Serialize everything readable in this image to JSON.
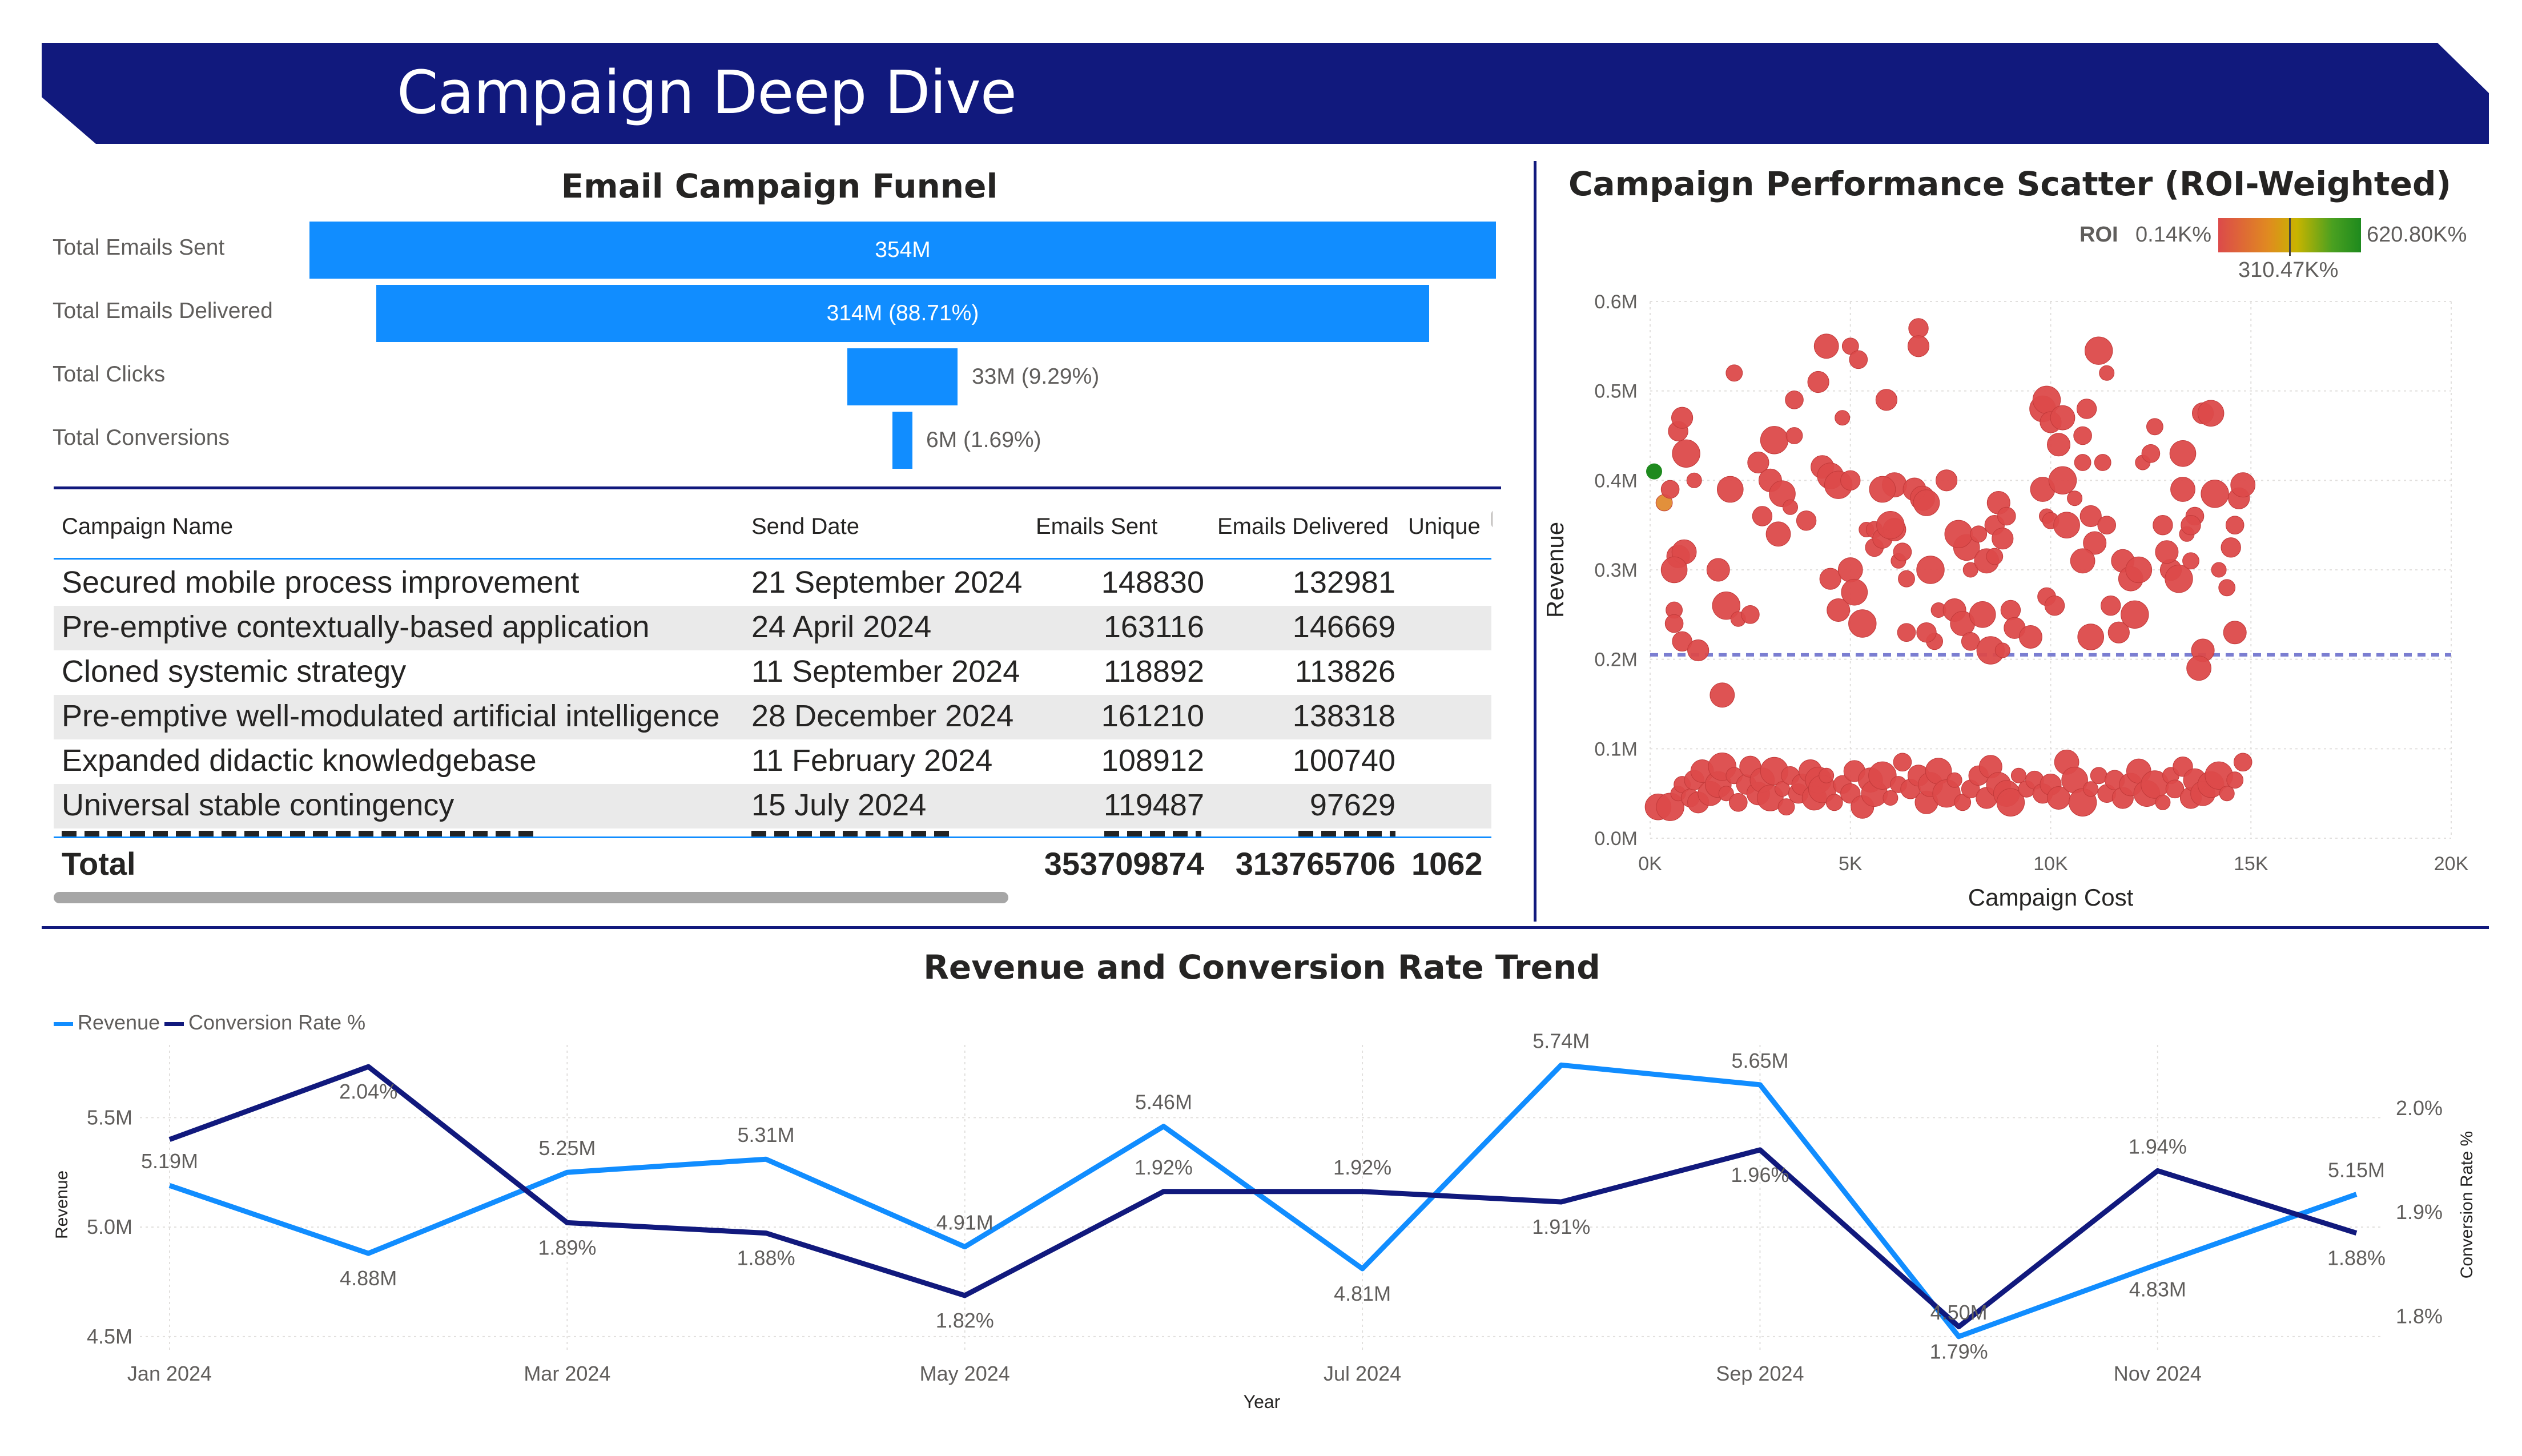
{
  "header": {
    "title": "Campaign Deep Dive",
    "color": "#11197d"
  },
  "funnel": {
    "title": "Email Campaign Funnel",
    "bar_color": "#118dff",
    "stages": [
      {
        "label": "Total Emails Sent",
        "value_label": "354M",
        "value": 354
      },
      {
        "label": "Total Emails Delivered",
        "value_label": "314M (88.71%)",
        "value": 314
      },
      {
        "label": "Total Clicks",
        "value_label": "33M (9.29%)",
        "value": 33
      },
      {
        "label": "Total Conversions",
        "value_label": "6M (1.69%)",
        "value": 6
      }
    ]
  },
  "table": {
    "columns": [
      "Campaign Name",
      "Send Date",
      "Emails Sent",
      "Emails Delivered",
      "Unique"
    ],
    "rows": [
      [
        "Secured mobile process improvement",
        "21 September 2024",
        "148830",
        "132981"
      ],
      [
        "Pre-emptive contextually-based application",
        "24 April 2024",
        "163116",
        "146669"
      ],
      [
        "Cloned systemic strategy",
        "11 September 2024",
        "118892",
        "113826"
      ],
      [
        "Pre-emptive well-modulated artificial intelligence",
        "28 December 2024",
        "161210",
        "138318"
      ],
      [
        "Expanded didactic knowledgebase",
        "11 February 2024",
        "108912",
        "100740"
      ],
      [
        "Universal stable contingency",
        "15 July 2024",
        "119487",
        "97629"
      ]
    ],
    "total": {
      "label": "Total",
      "emails_sent": "353709874",
      "emails_delivered": "313765706",
      "unique": "1062"
    }
  },
  "scatter": {
    "title": "Campaign Performance Scatter (ROI-Weighted)",
    "roi_legend": {
      "label": "ROI",
      "min": "0.14K%",
      "mid": "310.47K%",
      "max": "620.80K%"
    },
    "x_axis_title": "Campaign Cost",
    "y_axis_title": "Revenue",
    "x_ticks": [
      "0K",
      "5K",
      "10K",
      "15K",
      "20K"
    ],
    "y_ticks": [
      "0.0M",
      "0.1M",
      "0.2M",
      "0.3M",
      "0.4M",
      "0.5M",
      "0.6M"
    ],
    "average_line_value": 0.205
  },
  "trend": {
    "title": "Revenue and Conversion Rate Trend",
    "x_axis_title": "Year",
    "y_left_title": "Revenue",
    "y_right_title": "Conversion Rate %",
    "x_ticks": [
      "Jan 2024",
      "Mar 2024",
      "May 2024",
      "Jul 2024",
      "Sep 2024",
      "Nov 2024"
    ],
    "y_left_ticks": [
      "5.5M",
      "5.0M",
      "4.5M"
    ],
    "y_right_ticks": [
      "2.0%",
      "1.9%",
      "1.8%"
    ]
  },
  "chart_data": [
    {
      "type": "bar",
      "title": "Email Campaign Funnel",
      "categories": [
        "Total Emails Sent",
        "Total Emails Delivered",
        "Total Clicks",
        "Total Conversions"
      ],
      "values": [
        354,
        314,
        33,
        6
      ],
      "data_labels": [
        "354M",
        "314M (88.71%)",
        "33M (9.29%)",
        "6M (1.69%)"
      ]
    },
    {
      "type": "scatter",
      "title": "Campaign Performance Scatter (ROI-Weighted)",
      "xlabel": "Campaign Cost",
      "ylabel": "Revenue",
      "xlim": [
        0,
        20000
      ],
      "ylim": [
        0,
        0.6
      ],
      "average_revenue": 0.205,
      "points": [
        [
          100,
          0.41
        ],
        [
          350,
          0.375
        ],
        [
          500,
          0.39
        ],
        [
          700,
          0.455
        ],
        [
          800,
          0.47
        ],
        [
          700,
          0.315
        ],
        [
          850,
          0.32
        ],
        [
          600,
          0.3
        ],
        [
          900,
          0.43
        ],
        [
          1100,
          0.4
        ],
        [
          600,
          0.255
        ],
        [
          600,
          0.24
        ],
        [
          800,
          0.22
        ],
        [
          1200,
          0.21
        ],
        [
          1700,
          0.3
        ],
        [
          1800,
          0.16
        ],
        [
          2000,
          0.39
        ],
        [
          1900,
          0.26
        ],
        [
          2200,
          0.245
        ],
        [
          2100,
          0.52
        ],
        [
          2500,
          0.25
        ],
        [
          2800,
          0.36
        ],
        [
          2700,
          0.42
        ],
        [
          3000,
          0.4
        ],
        [
          3200,
          0.34
        ],
        [
          3300,
          0.385
        ],
        [
          3100,
          0.445
        ],
        [
          3500,
          0.37
        ],
        [
          3600,
          0.45
        ],
        [
          3600,
          0.49
        ],
        [
          3900,
          0.355
        ],
        [
          4200,
          0.51
        ],
        [
          4300,
          0.415
        ],
        [
          4400,
          0.55
        ],
        [
          4500,
          0.405
        ],
        [
          4700,
          0.395
        ],
        [
          4800,
          0.47
        ],
        [
          5000,
          0.55
        ],
        [
          5200,
          0.535
        ],
        [
          5000,
          0.4
        ],
        [
          4500,
          0.29
        ],
        [
          4700,
          0.255
        ],
        [
          5000,
          0.3
        ],
        [
          5100,
          0.275
        ],
        [
          5300,
          0.24
        ],
        [
          5400,
          0.345
        ],
        [
          5600,
          0.345
        ],
        [
          5600,
          0.325
        ],
        [
          5800,
          0.335
        ],
        [
          5900,
          0.49
        ],
        [
          6100,
          0.345
        ],
        [
          6100,
          0.395
        ],
        [
          5800,
          0.39
        ],
        [
          6000,
          0.35
        ],
        [
          6200,
          0.31
        ],
        [
          6400,
          0.29
        ],
        [
          6300,
          0.32
        ],
        [
          6700,
          0.57
        ],
        [
          6700,
          0.55
        ],
        [
          6600,
          0.39
        ],
        [
          6800,
          0.38
        ],
        [
          6900,
          0.375
        ],
        [
          7000,
          0.3
        ],
        [
          7200,
          0.255
        ],
        [
          7100,
          0.22
        ],
        [
          6400,
          0.23
        ],
        [
          6900,
          0.23
        ],
        [
          7400,
          0.4
        ],
        [
          7600,
          0.255
        ],
        [
          7800,
          0.24
        ],
        [
          7900,
          0.325
        ],
        [
          7700,
          0.34
        ],
        [
          8000,
          0.3
        ],
        [
          8200,
          0.34
        ],
        [
          8000,
          0.22
        ],
        [
          8600,
          0.35
        ],
        [
          8800,
          0.335
        ],
        [
          8700,
          0.375
        ],
        [
          8400,
          0.31
        ],
        [
          8300,
          0.25
        ],
        [
          8500,
          0.21
        ],
        [
          8800,
          0.21
        ],
        [
          8600,
          0.315
        ],
        [
          8900,
          0.36
        ],
        [
          9000,
          0.255
        ],
        [
          9100,
          0.235
        ],
        [
          9500,
          0.225
        ],
        [
          9800,
          0.39
        ],
        [
          9800,
          0.48
        ],
        [
          9900,
          0.49
        ],
        [
          9900,
          0.36
        ],
        [
          10000,
          0.355
        ],
        [
          9900,
          0.27
        ],
        [
          10100,
          0.26
        ],
        [
          10000,
          0.465
        ],
        [
          10200,
          0.44
        ],
        [
          10300,
          0.47
        ],
        [
          10400,
          0.35
        ],
        [
          10300,
          0.4
        ],
        [
          10600,
          0.38
        ],
        [
          10800,
          0.42
        ],
        [
          10800,
          0.45
        ],
        [
          10900,
          0.48
        ],
        [
          11000,
          0.36
        ],
        [
          11100,
          0.33
        ],
        [
          10800,
          0.31
        ],
        [
          11000,
          0.225
        ],
        [
          11200,
          0.545
        ],
        [
          11400,
          0.52
        ],
        [
          11300,
          0.42
        ],
        [
          11400,
          0.35
        ],
        [
          11500,
          0.26
        ],
        [
          11700,
          0.23
        ],
        [
          11800,
          0.31
        ],
        [
          12000,
          0.29
        ],
        [
          12200,
          0.3
        ],
        [
          12100,
          0.25
        ],
        [
          12300,
          0.42
        ],
        [
          12600,
          0.46
        ],
        [
          12500,
          0.43
        ],
        [
          12800,
          0.35
        ],
        [
          13000,
          0.3
        ],
        [
          12900,
          0.32
        ],
        [
          13300,
          0.39
        ],
        [
          13300,
          0.43
        ],
        [
          13200,
          0.29
        ],
        [
          13400,
          0.34
        ],
        [
          13500,
          0.31
        ],
        [
          13600,
          0.36
        ],
        [
          13500,
          0.35
        ],
        [
          13800,
          0.475
        ],
        [
          13800,
          0.21
        ],
        [
          13700,
          0.19
        ],
        [
          14000,
          0.475
        ],
        [
          14100,
          0.385
        ],
        [
          14200,
          0.3
        ],
        [
          14400,
          0.28
        ],
        [
          14600,
          0.35
        ],
        [
          14500,
          0.325
        ],
        [
          14700,
          0.38
        ],
        [
          14600,
          0.23
        ],
        [
          14800,
          0.395
        ],
        [
          200,
          0.035
        ],
        [
          500,
          0.035
        ],
        [
          700,
          0.05
        ],
        [
          800,
          0.06
        ],
        [
          1000,
          0.045
        ],
        [
          1100,
          0.065
        ],
        [
          1200,
          0.04
        ],
        [
          1300,
          0.075
        ],
        [
          1500,
          0.05
        ],
        [
          1700,
          0.06
        ],
        [
          1800,
          0.08
        ],
        [
          1900,
          0.05
        ],
        [
          2100,
          0.07
        ],
        [
          2200,
          0.04
        ],
        [
          2400,
          0.06
        ],
        [
          2500,
          0.08
        ],
        [
          2700,
          0.05
        ],
        [
          2800,
          0.065
        ],
        [
          3000,
          0.045
        ],
        [
          3100,
          0.075
        ],
        [
          3300,
          0.055
        ],
        [
          3400,
          0.035
        ],
        [
          3500,
          0.07
        ],
        [
          3700,
          0.05
        ],
        [
          3800,
          0.06
        ],
        [
          4000,
          0.075
        ],
        [
          4100,
          0.045
        ],
        [
          4200,
          0.065
        ],
        [
          4300,
          0.055
        ],
        [
          4400,
          0.07
        ],
        [
          4600,
          0.04
        ],
        [
          4800,
          0.06
        ],
        [
          5000,
          0.05
        ],
        [
          5100,
          0.075
        ],
        [
          5300,
          0.035
        ],
        [
          5500,
          0.065
        ],
        [
          5600,
          0.05
        ],
        [
          5800,
          0.07
        ],
        [
          6000,
          0.045
        ],
        [
          6200,
          0.06
        ],
        [
          6300,
          0.085
        ],
        [
          6500,
          0.055
        ],
        [
          6700,
          0.07
        ],
        [
          6900,
          0.04
        ],
        [
          7000,
          0.06
        ],
        [
          7200,
          0.075
        ],
        [
          7400,
          0.05
        ],
        [
          7600,
          0.065
        ],
        [
          7800,
          0.04
        ],
        [
          8000,
          0.055
        ],
        [
          8200,
          0.07
        ],
        [
          8400,
          0.045
        ],
        [
          8500,
          0.08
        ],
        [
          8700,
          0.06
        ],
        [
          8900,
          0.05
        ],
        [
          9000,
          0.04
        ],
        [
          9200,
          0.07
        ],
        [
          9400,
          0.055
        ],
        [
          9600,
          0.065
        ],
        [
          9800,
          0.05
        ],
        [
          10000,
          0.06
        ],
        [
          10200,
          0.045
        ],
        [
          10400,
          0.085
        ],
        [
          10600,
          0.065
        ],
        [
          10800,
          0.04
        ],
        [
          11000,
          0.055
        ],
        [
          11200,
          0.07
        ],
        [
          11400,
          0.05
        ],
        [
          11600,
          0.065
        ],
        [
          11800,
          0.045
        ],
        [
          12000,
          0.06
        ],
        [
          12200,
          0.075
        ],
        [
          12400,
          0.05
        ],
        [
          12600,
          0.06
        ],
        [
          12800,
          0.04
        ],
        [
          13000,
          0.07
        ],
        [
          13100,
          0.055
        ],
        [
          13300,
          0.08
        ],
        [
          13500,
          0.045
        ],
        [
          13600,
          0.065
        ],
        [
          13800,
          0.05
        ],
        [
          14000,
          0.06
        ],
        [
          14200,
          0.07
        ],
        [
          14400,
          0.05
        ],
        [
          14600,
          0.065
        ],
        [
          14800,
          0.085
        ]
      ]
    },
    {
      "type": "line",
      "title": "Revenue and Conversion Rate Trend",
      "xlabel": "Year",
      "x": [
        "Jan 2024",
        "Feb 2024",
        "Mar 2024",
        "Apr 2024",
        "May 2024",
        "Jun 2024",
        "Jul 2024",
        "Aug 2024",
        "Sep 2024",
        "Oct 2024",
        "Nov 2024",
        "Dec 2024"
      ],
      "series": [
        {
          "name": "Revenue",
          "axis": "left",
          "color": "#118dff",
          "values": [
            5.19,
            4.88,
            5.25,
            5.31,
            4.91,
            5.46,
            4.81,
            5.74,
            5.65,
            4.5,
            4.83,
            5.15
          ],
          "labels": [
            "5.19M",
            "4.88M",
            "5.25M",
            "5.31M",
            "4.91M",
            "5.46M",
            "4.81M",
            "5.74M",
            "5.65M",
            "4.50M",
            "4.83M",
            "5.15M"
          ]
        },
        {
          "name": "Conversion Rate %",
          "axis": "right",
          "color": "#11197d",
          "values": [
            1.97,
            2.04,
            1.89,
            1.88,
            1.82,
            1.92,
            1.92,
            1.91,
            1.96,
            1.79,
            1.94,
            1.88
          ],
          "labels": [
            "",
            "2.04%",
            "1.89%",
            "1.88%",
            "1.82%",
            "1.92%",
            "1.92%",
            "1.91%",
            "1.96%",
            "1.79%",
            "1.94%",
            "1.88%"
          ]
        }
      ],
      "y_left_lim": [
        4.45,
        5.78
      ],
      "y_right_lim": [
        1.77,
        2.05
      ]
    }
  ]
}
